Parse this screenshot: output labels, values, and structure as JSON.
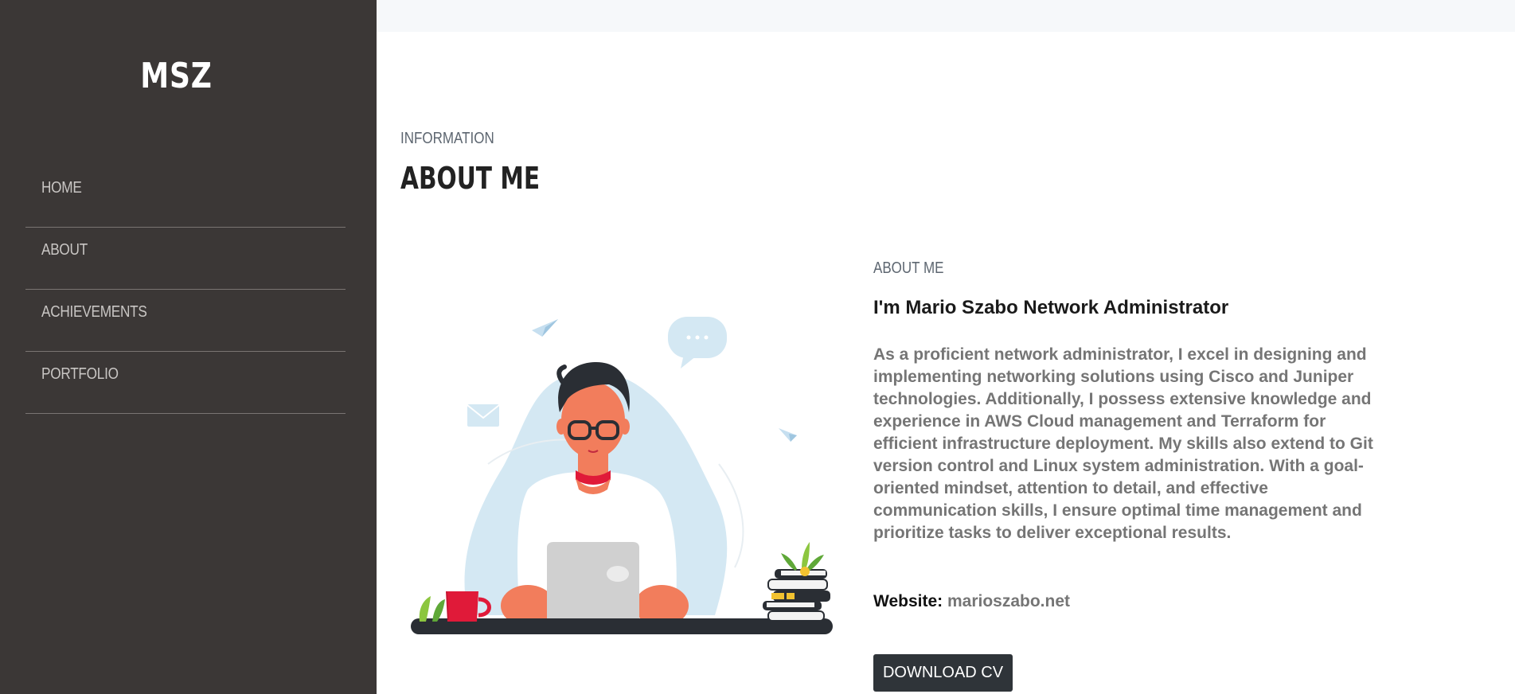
{
  "sidebar": {
    "logo": "MSZ",
    "nav": [
      "HOME",
      "ABOUT",
      "ACHIEVEMENTS",
      "PORTFOLIO"
    ]
  },
  "section": {
    "subtitle": "INFORMATION",
    "title": "ABOUT ME"
  },
  "about": {
    "label": "ABOUT ME",
    "heading": "I'm Mario Szabo Network Administrator",
    "body": "As a proficient network administrator, I excel in designing and implementing networking solutions using Cisco and Juniper technologies. Additionally, I possess extensive knowledge and experience in AWS Cloud management and Terraform for efficient infrastructure deployment. My skills also extend to Git version control and Linux system administration. With a goal-oriented mindset, attention to detail, and effective communication skills, I ensure optimal time management and prioritize tasks to deliver exceptional results.",
    "website_label": "Website:",
    "website_value": "marioszabo.net",
    "cv_button": "DOWNLOAD CV"
  },
  "colors": {
    "sidebar_bg": "#3b3736",
    "button_bg": "#2f3439",
    "body_text": "#757575"
  },
  "illustration": {
    "icon": "person-with-laptop-illustration"
  }
}
